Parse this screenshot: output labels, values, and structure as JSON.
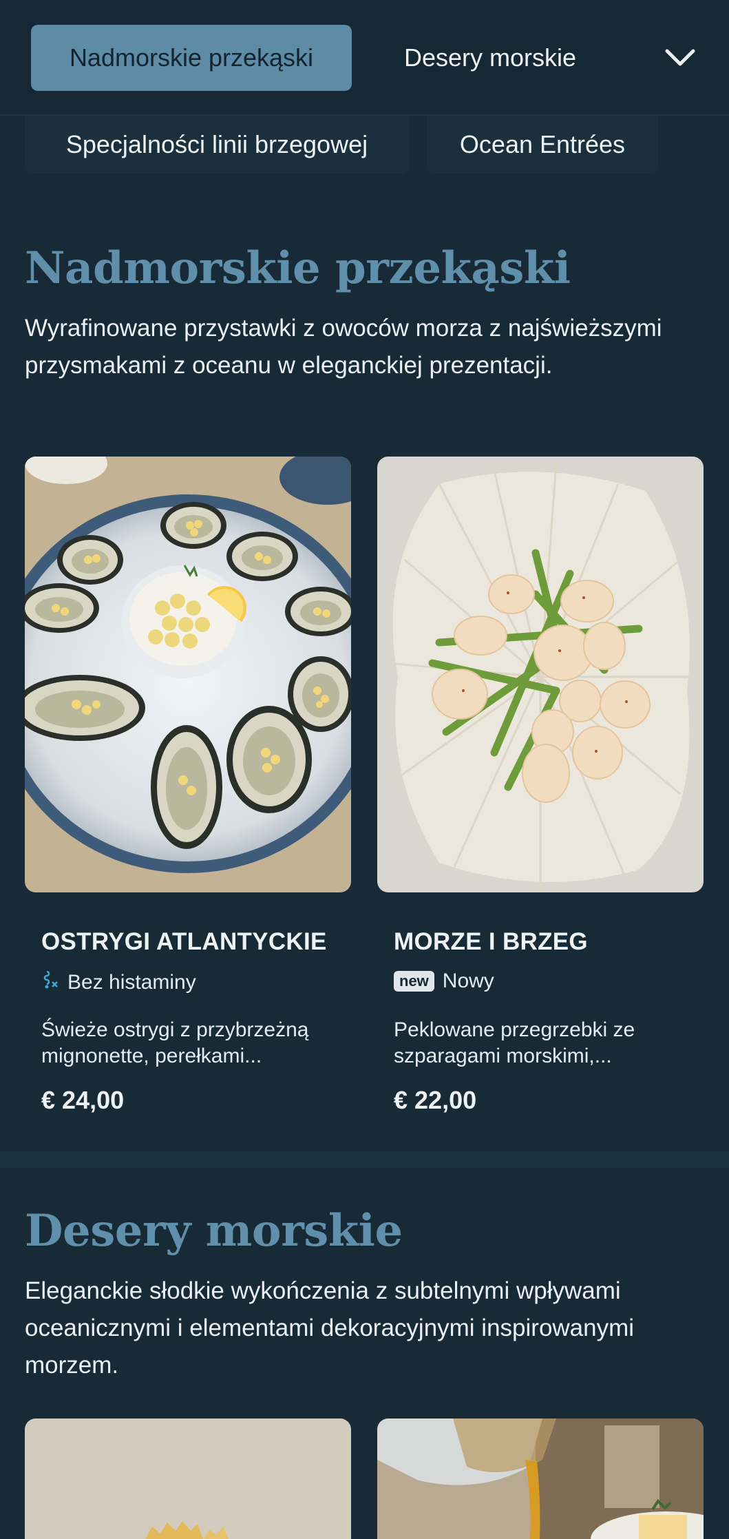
{
  "nav": {
    "active_tab": "Nadmorskie przekąski",
    "tab2": "Desery morskie",
    "more_icon": "chevron-down-icon",
    "subtab1": "Specjalności linii brzegowej",
    "subtab2": "Ocean Entrées"
  },
  "sections": [
    {
      "title": "Nadmorskie przekąski",
      "description": "Wyrafinowane przystawki z owoców morza z najświeższymi przysmakami z oceanu w eleganckiej prezentacji.",
      "items": [
        {
          "name": "OSTRYGI ATLANTYCKIE",
          "tag_icon": "histamine-free-icon",
          "tag": "Bez histaminy",
          "description": "Świeże ostrygi z przybrzeżną mignonette, perełkami...",
          "price": "€ 24,00"
        },
        {
          "name": "MORZE I BRZEG",
          "badge": "new",
          "tag": "Nowy",
          "description": "Peklowane przegrzebki ze szparagami morskimi,...",
          "price": "€ 22,00"
        }
      ]
    },
    {
      "title": "Desery morskie",
      "description": "Eleganckie słodkie wykończenia z subtelnymi wpływami oceanicznymi i elementami dekoracyjnymi inspirowanymi morzem."
    }
  ],
  "colors": {
    "background": "#172a36",
    "accent": "#5e8ca7",
    "title": "#5f8fab"
  }
}
